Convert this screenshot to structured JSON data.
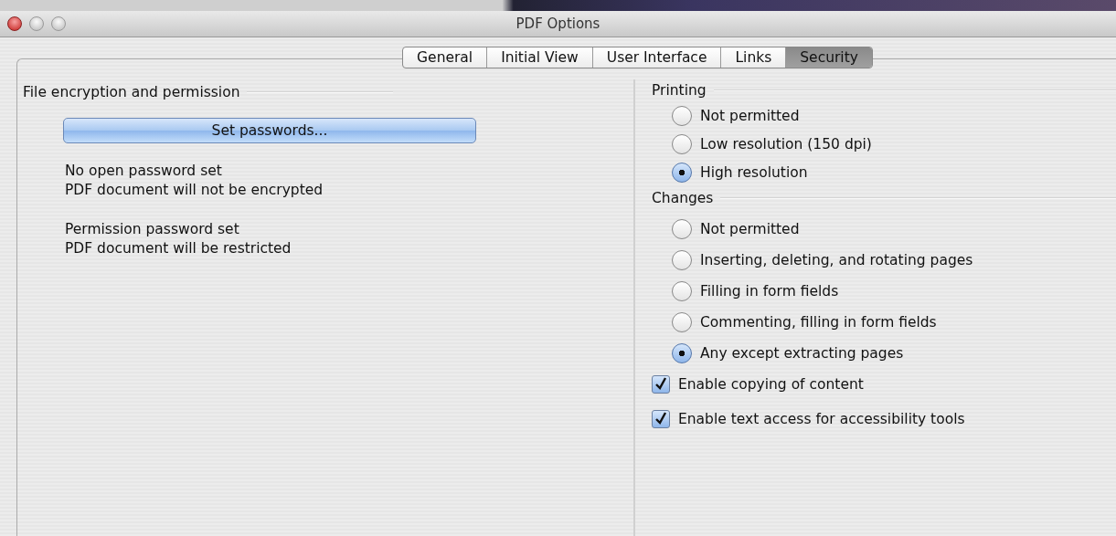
{
  "window": {
    "title": "PDF Options"
  },
  "tabs": [
    {
      "label": "General",
      "selected": false
    },
    {
      "label": "Initial View",
      "selected": false
    },
    {
      "label": "User Interface",
      "selected": false
    },
    {
      "label": "Links",
      "selected": false
    },
    {
      "label": "Security",
      "selected": true
    }
  ],
  "encryption": {
    "heading": "File encryption and permission",
    "button": "Set passwords...",
    "status_lines": [
      "No open password set",
      "PDF document will not be encrypted"
    ],
    "permission_lines": [
      "Permission password set",
      "PDF document will be restricted"
    ]
  },
  "printing": {
    "heading": "Printing",
    "options": [
      {
        "label": "Not permitted",
        "selected": false
      },
      {
        "label": "Low resolution (150 dpi)",
        "selected": false
      },
      {
        "label": "High resolution",
        "selected": true
      }
    ]
  },
  "changes": {
    "heading": "Changes",
    "options": [
      {
        "label": "Not permitted",
        "selected": false
      },
      {
        "label": "Inserting, deleting, and rotating pages",
        "selected": false
      },
      {
        "label": "Filling in form fields",
        "selected": false
      },
      {
        "label": "Commenting, filling in form fields",
        "selected": false
      },
      {
        "label": "Any except extracting pages",
        "selected": true
      }
    ]
  },
  "checkboxes": [
    {
      "label": "Enable copying of content",
      "checked": true
    },
    {
      "label": "Enable text access for accessibility tools",
      "checked": true
    }
  ]
}
